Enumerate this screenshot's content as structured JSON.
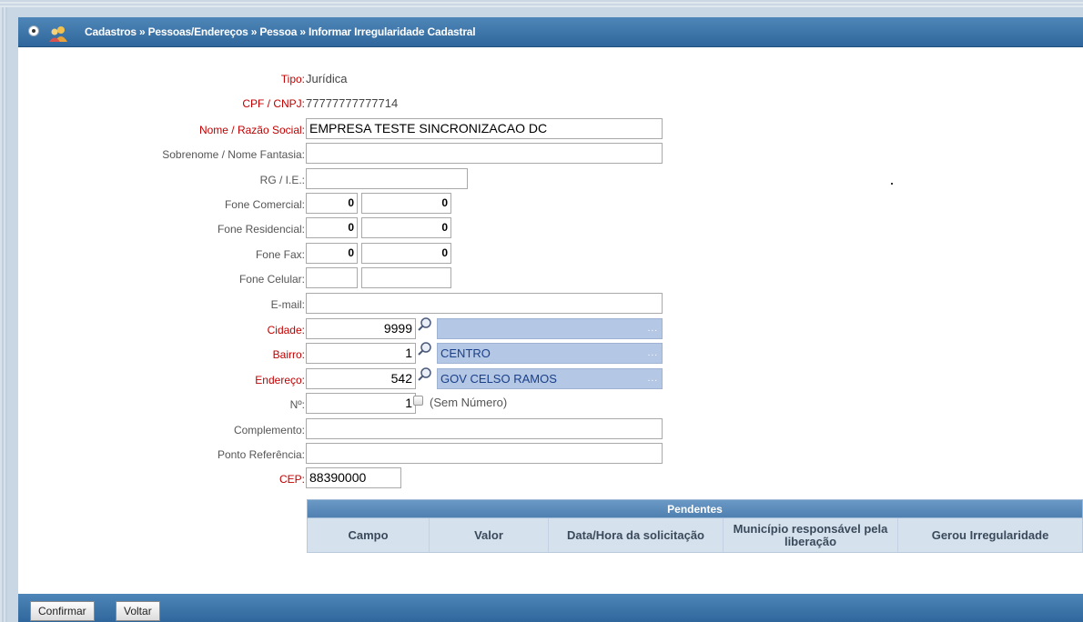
{
  "titlebar": {
    "title": "Cadastros » Pessoas/Endereços » Pessoa » Informar Irregularidade Cadastral"
  },
  "form": {
    "tipo_label": "Tipo:",
    "tipo_value": "Jurídica",
    "cpf_label": "CPF / CNPJ:",
    "cpf_value": "77777777777714",
    "nome_label": "Nome / Razão Social:",
    "nome_value": "EMPRESA TESTE SINCRONIZACAO DC",
    "sobrenome_label": "Sobrenome / Nome Fantasia:",
    "sobrenome_value": "",
    "rg_label": "RG / I.E.:",
    "rg_value": "",
    "fone_comercial_label": "Fone Comercial:",
    "fone_comercial_ddd": "0",
    "fone_comercial_num": "0",
    "fone_residencial_label": "Fone Residencial:",
    "fone_residencial_ddd": "0",
    "fone_residencial_num": "0",
    "fone_fax_label": "Fone Fax:",
    "fone_fax_ddd": "0",
    "fone_fax_num": "0",
    "fone_celular_label": "Fone Celular:",
    "fone_celular_ddd": "",
    "fone_celular_num": "",
    "email_label": "E-mail:",
    "email_value": "",
    "cidade_label": "Cidade:",
    "cidade_code": "9999",
    "cidade_name": "",
    "bairro_label": "Bairro:",
    "bairro_code": "1",
    "bairro_name": "CENTRO",
    "endereco_label": "Endereço:",
    "endereco_code": "542",
    "endereco_name": "GOV CELSO RAMOS",
    "numero_label": "Nº:",
    "numero_value": "1",
    "sem_numero_label": "(Sem Número)",
    "complemento_label": "Complemento:",
    "complemento_value": "",
    "ponto_ref_label": "Ponto Referência:",
    "ponto_ref_value": "",
    "cep_label": "CEP:",
    "cep_value": "88390000",
    "lookup_dots": "..."
  },
  "pendentes": {
    "title": "Pendentes",
    "columns": [
      "Campo",
      "Valor",
      "Data/Hora da solicitação",
      "Município responsável pela liberação",
      "Gerou Irregularidade"
    ]
  },
  "footer": {
    "confirm_label": "Confirmar",
    "back_label": "Voltar"
  },
  "colors": {
    "title_bar": "#2f679c",
    "required_label": "#c00000",
    "lookup_field": "#b4c7e4"
  },
  "icons": {
    "title_left": "radio-icon",
    "title_app": "users-icon",
    "lookup": "magnifier-icon"
  }
}
